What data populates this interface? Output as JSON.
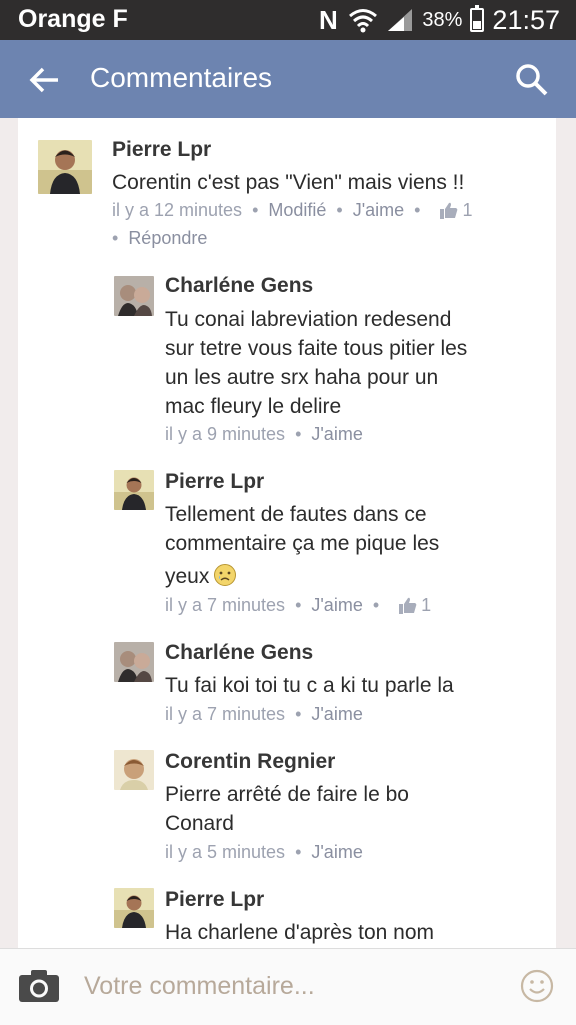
{
  "status_bar": {
    "carrier": "Orange F",
    "network_letter": "N",
    "battery_percent": "38%",
    "battery_level": 0.38,
    "time": "21:57"
  },
  "app_bar": {
    "title": "Commentaires"
  },
  "comments": [
    {
      "author": "Pierre Lpr",
      "lines": [
        "Corentin c'est pas \"Vien\" mais viens !!"
      ],
      "time": "il y a 12 minutes",
      "edited": "Modifié",
      "like": "J'aime",
      "likes": "1",
      "reply": "Répondre"
    },
    {
      "author": "Charléne Gens",
      "lines": [
        "Tu conai labreviation redesend",
        "sur tetre vous faite tous pitier les",
        "un les autre srx haha pour un",
        "mac fleury le delire"
      ],
      "time": "il y a 9 minutes",
      "like": "J'aime"
    },
    {
      "author": "Pierre Lpr",
      "lines": [
        "Tellement de fautes dans ce",
        "commentaire ça me pique les",
        "yeux"
      ],
      "time": "il y a 7 minutes",
      "like": "J'aime",
      "likes": "1"
    },
    {
      "author": "Charléne Gens",
      "lines": [
        "Tu fai koi toi tu c a ki tu parle la"
      ],
      "time": "il y a 7 minutes",
      "like": "J'aime"
    },
    {
      "author": "Corentin Regnier",
      "lines": [
        "Pierre arrêté de faire le bo",
        "Conard"
      ],
      "time": "il y a 5 minutes",
      "like": "J'aime"
    },
    {
      "author": "Pierre Lpr",
      "lines": [
        "Ha charlene d'après ton nom"
      ]
    }
  ],
  "composer": {
    "placeholder": "Votre commentaire..."
  },
  "icons": {
    "back": "arrow-left-icon",
    "search": "search-icon",
    "camera": "camera-icon",
    "emoji": "smiley-icon",
    "like": "thumbs-up-icon"
  },
  "colors": {
    "app_bar": "#6d84b0",
    "status_bar": "#2f2d2d",
    "meta_text": "#9da2b0"
  }
}
